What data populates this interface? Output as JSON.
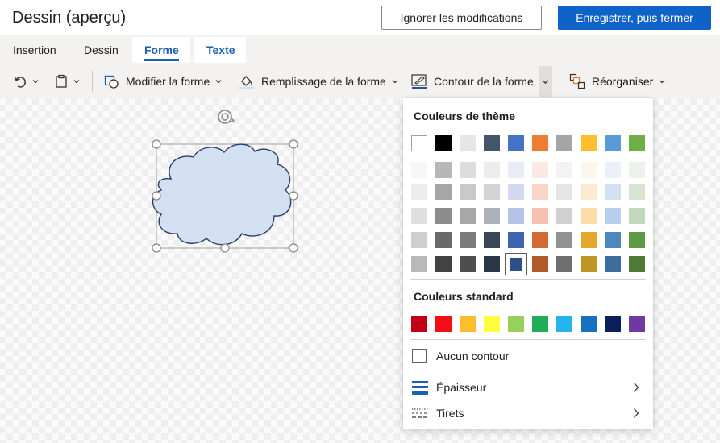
{
  "app": {
    "title": "Dessin (aperçu)",
    "ignore_label": "Ignorer les modifications",
    "save_label": "Enregistrer, puis fermer"
  },
  "tabs": [
    {
      "label": "Insertion",
      "active": false
    },
    {
      "label": "Dessin",
      "active": false
    },
    {
      "label": "Forme",
      "active": true
    },
    {
      "label": "Texte",
      "active": false
    }
  ],
  "ribbon": {
    "modify_shape": "Modifier la forme",
    "fill": "Remplissage de la forme",
    "outline": "Contour de la forme",
    "arrange": "Réorganiser"
  },
  "dropdown": {
    "theme_header": "Couleurs de thème",
    "standard_header": "Couleurs standard",
    "no_outline": "Aucun contour",
    "weight": "Épaisseur",
    "dashes": "Tirets",
    "theme_rows": [
      [
        "#ffffff",
        "#000000",
        "#e7e6e6",
        "#44546a",
        "#4472c4",
        "#ed7d31",
        "#a5a5a5",
        "#ffc000",
        "#5b9bd5",
        "#70ad47"
      ],
      [
        "#f2f2f2",
        "#7f7f7f",
        "#d0cece",
        "#d6dce4",
        "#d9e2f3",
        "#fbe5d5",
        "#ededed",
        "#fff2cc",
        "#deebf6",
        "#e2efd9"
      ],
      [
        "#d8d8d8",
        "#595959",
        "#aeabab",
        "#adb9ca",
        "#b4c6e7",
        "#f7cbac",
        "#dbdbdb",
        "#fee599",
        "#bdd7ee",
        "#c5e0b3"
      ],
      [
        "#bfbfbf",
        "#3f3f3f",
        "#757070",
        "#8496b0",
        "#8eaadb",
        "#f4b183",
        "#c9c9c9",
        "#ffd965",
        "#9dc3e6",
        "#a8d08d"
      ],
      [
        "#a5a5a5",
        "#262626",
        "#3a3838",
        "#323f4f",
        "#2f5496",
        "#c55a11",
        "#7b7b7b",
        "#bf9000",
        "#2e75b5",
        "#538135"
      ],
      [
        "#7f7f7f",
        "#0c0c0c",
        "#171616",
        "#222a35",
        "#1f3864",
        "#833c0b",
        "#525252",
        "#7f6000",
        "#1e4e79",
        "#375623"
      ]
    ],
    "theme_display_rows": [
      [
        "#ffffff",
        "#000000",
        "#e7e6e6",
        "#44546a",
        "#4472c4",
        "#ed7d31",
        "#a5a5a5",
        "#fbbf2d",
        "#5b9bd5",
        "#70ad47"
      ],
      [
        "#f7f7f7",
        "#b7b7b7",
        "#dcdcdc",
        "#ececec",
        "#e9ecf7",
        "#fce9e3",
        "#f3f3f3",
        "#fdf6ea",
        "#ecf1f9",
        "#ecf2ea"
      ],
      [
        "#ececec",
        "#a6a6a6",
        "#c9c9c9",
        "#d2d4d8",
        "#d2d9ee",
        "#f9d5c9",
        "#e5e5e5",
        "#fcebd0",
        "#d3e1f2",
        "#d7e5d2"
      ],
      [
        "#dfdfdf",
        "#8c8c8c",
        "#a8a8a8",
        "#adb2ba",
        "#b6c3e6",
        "#f5c0ae",
        "#d0d0d0",
        "#fcdca7",
        "#b7cfeb",
        "#c2d8bb"
      ],
      [
        "#cfcfcf",
        "#6a6a6a",
        "#7b7b7b",
        "#394558",
        "#3e64b0",
        "#d36a32",
        "#919191",
        "#e2a92a",
        "#4c87bd",
        "#5f9a43"
      ],
      [
        "#b9b9b9",
        "#424242",
        "#4d4d4d",
        "#2a3548",
        "#2f4f8a",
        "#b35a2a",
        "#6f6f6f",
        "#c09425",
        "#3d6e9b",
        "#4d7b36"
      ]
    ],
    "selected_theme": [
      5,
      4
    ],
    "standard_colors": [
      "#c00000",
      "#ff0000",
      "#ffc000",
      "#ffff00",
      "#92d050",
      "#00b050",
      "#00b0f0",
      "#0070c0",
      "#002060",
      "#7030a0"
    ],
    "standard_display": [
      "#c00016",
      "#f50d1a",
      "#fbbf2d",
      "#fefe3d",
      "#98d05c",
      "#20ad57",
      "#25b5ec",
      "#1871bf",
      "#0c1f5a",
      "#7038a3"
    ]
  },
  "colors": {
    "accent": "#1a5fb4",
    "primary_button": "#0f62c7",
    "shape_fill": "#d3e0f1",
    "shape_stroke": "#2b3f67"
  },
  "icons": {
    "undo": "undo-icon",
    "paste": "clipboard-icon",
    "modify": "edit-shape-icon",
    "fill": "paint-bucket-icon",
    "outline": "pen-icon",
    "arrange": "arrange-icon",
    "rotate": "rotate-icon"
  }
}
